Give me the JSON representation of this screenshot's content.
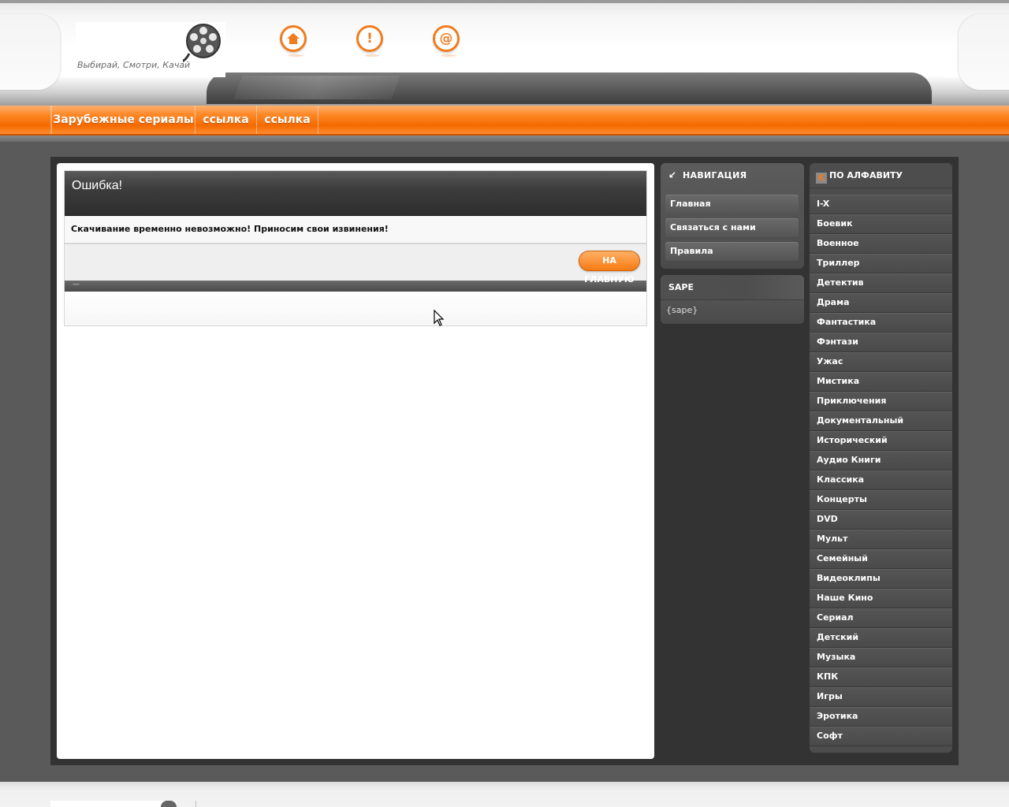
{
  "header": {
    "slogan": "Выбирай, Смотри, Качай",
    "icons": [
      "home-icon",
      "info-icon",
      "mail-icon"
    ],
    "icon_glyphs": {
      "home": "⌂",
      "info": "!",
      "mail": "@"
    }
  },
  "menu": {
    "items": [
      {
        "label": "Зарубежные сериалы"
      },
      {
        "label": "ссылка"
      },
      {
        "label": "ссылка"
      }
    ]
  },
  "main": {
    "error_title": "Ошибка!",
    "error_message": "Скачивание временно невозможно! Приносим свои извинения!",
    "home_button": "НА ГЛАВНУЮ",
    "bar_text": "—"
  },
  "navigation": {
    "title": "НАВИГАЦИЯ",
    "items": [
      {
        "label": "Главная"
      },
      {
        "label": "Связаться с нами"
      },
      {
        "label": "Правила"
      }
    ]
  },
  "sape": {
    "title": "SAPE",
    "content": "{sape}"
  },
  "alphabet": {
    "title": "ПО АЛФАВИТУ",
    "items": [
      "I-X",
      "Боевик",
      "Военное",
      "Триллер",
      "Детектив",
      "Драма",
      "Фантастика",
      "Фэнтази",
      "Ужас",
      "Мистика",
      "Приключения",
      "Документальный",
      "Исторический",
      "Аудио Книги",
      "Классика",
      "Концерты",
      "DVD",
      "Мульт",
      "Семейный",
      "Видеоклипы",
      "Наше Кино",
      "Сериал",
      "Детский",
      "Музыка",
      "КПК",
      "Игры",
      "Эротика",
      "Софт"
    ]
  },
  "colors": {
    "accent": "#f47a1a",
    "dark_panel": "#333333",
    "sidebar_block": "#4d4d4d"
  }
}
